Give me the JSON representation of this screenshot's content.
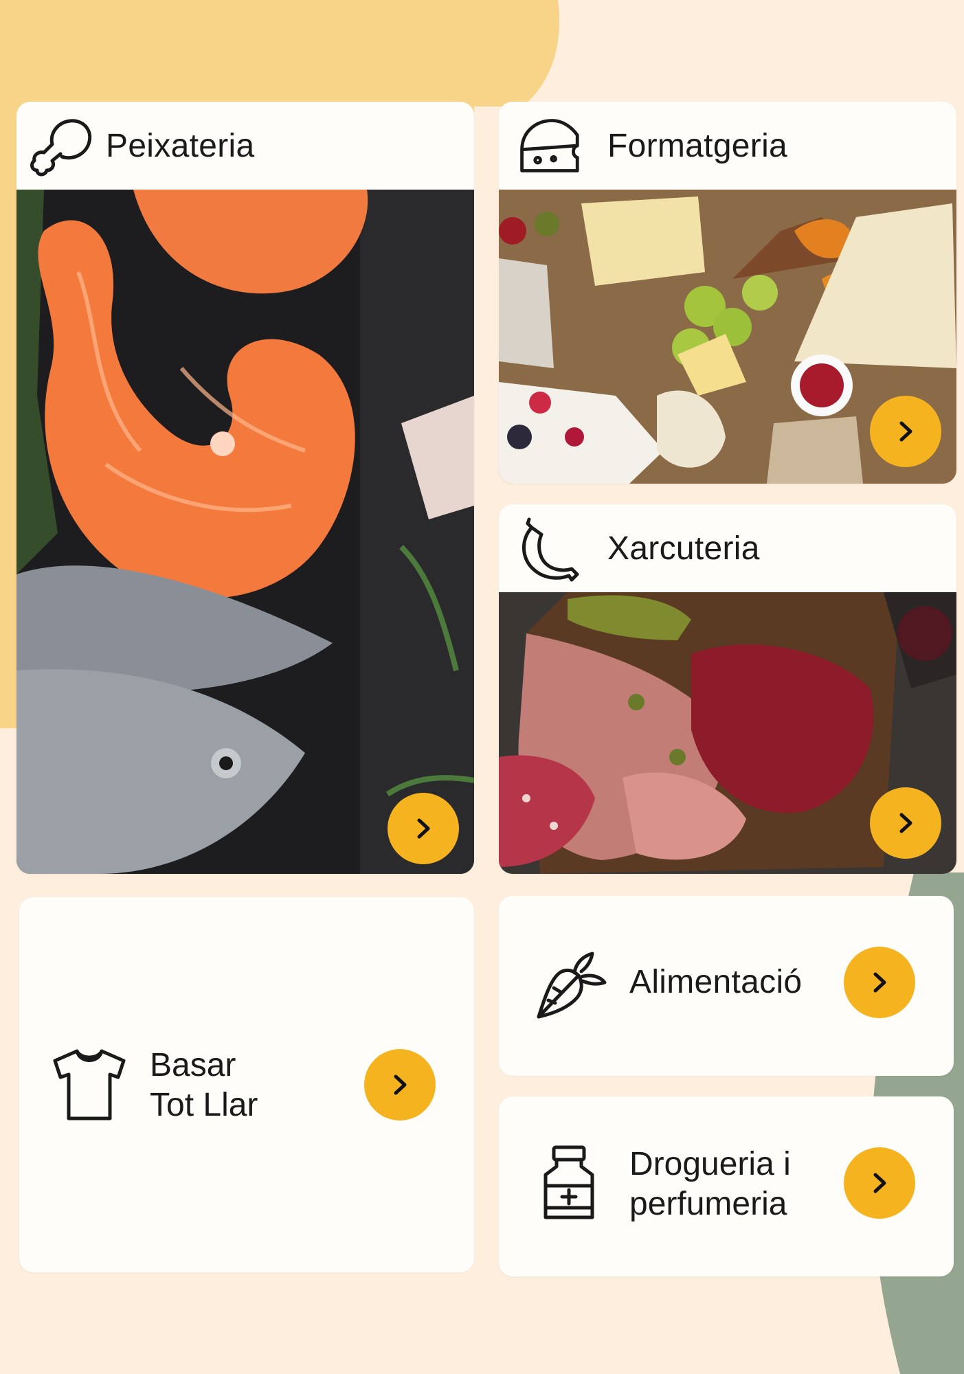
{
  "colors": {
    "background": "#fdeedd",
    "accent_blob": "#f8d488",
    "sage_blob": "#94a68f",
    "card": "#fffdfa",
    "button": "#f5b41f",
    "text": "#1a1a1a"
  },
  "categories": {
    "peixateria": {
      "label": "Peixateria",
      "icon": "drumstick-icon",
      "image": "salmon-and-fish-photo"
    },
    "formatgeria": {
      "label": "Formatgeria",
      "icon": "cheese-icon",
      "image": "cheese-board-photo"
    },
    "xarcuteria": {
      "label": "Xarcuteria",
      "icon": "sausage-icon",
      "image": "cured-meats-photo"
    },
    "basar": {
      "label_line1": "Basar",
      "label_line2": "Tot Llar",
      "icon": "t-shirt-icon"
    },
    "alimentacio": {
      "label": "Alimentació",
      "icon": "carrot-icon"
    },
    "drogueria": {
      "label_line1": "Drogueria i",
      "label_line2": "perfumeria",
      "icon": "medicine-bottle-icon"
    }
  },
  "button_icon": "chevron-right-icon"
}
